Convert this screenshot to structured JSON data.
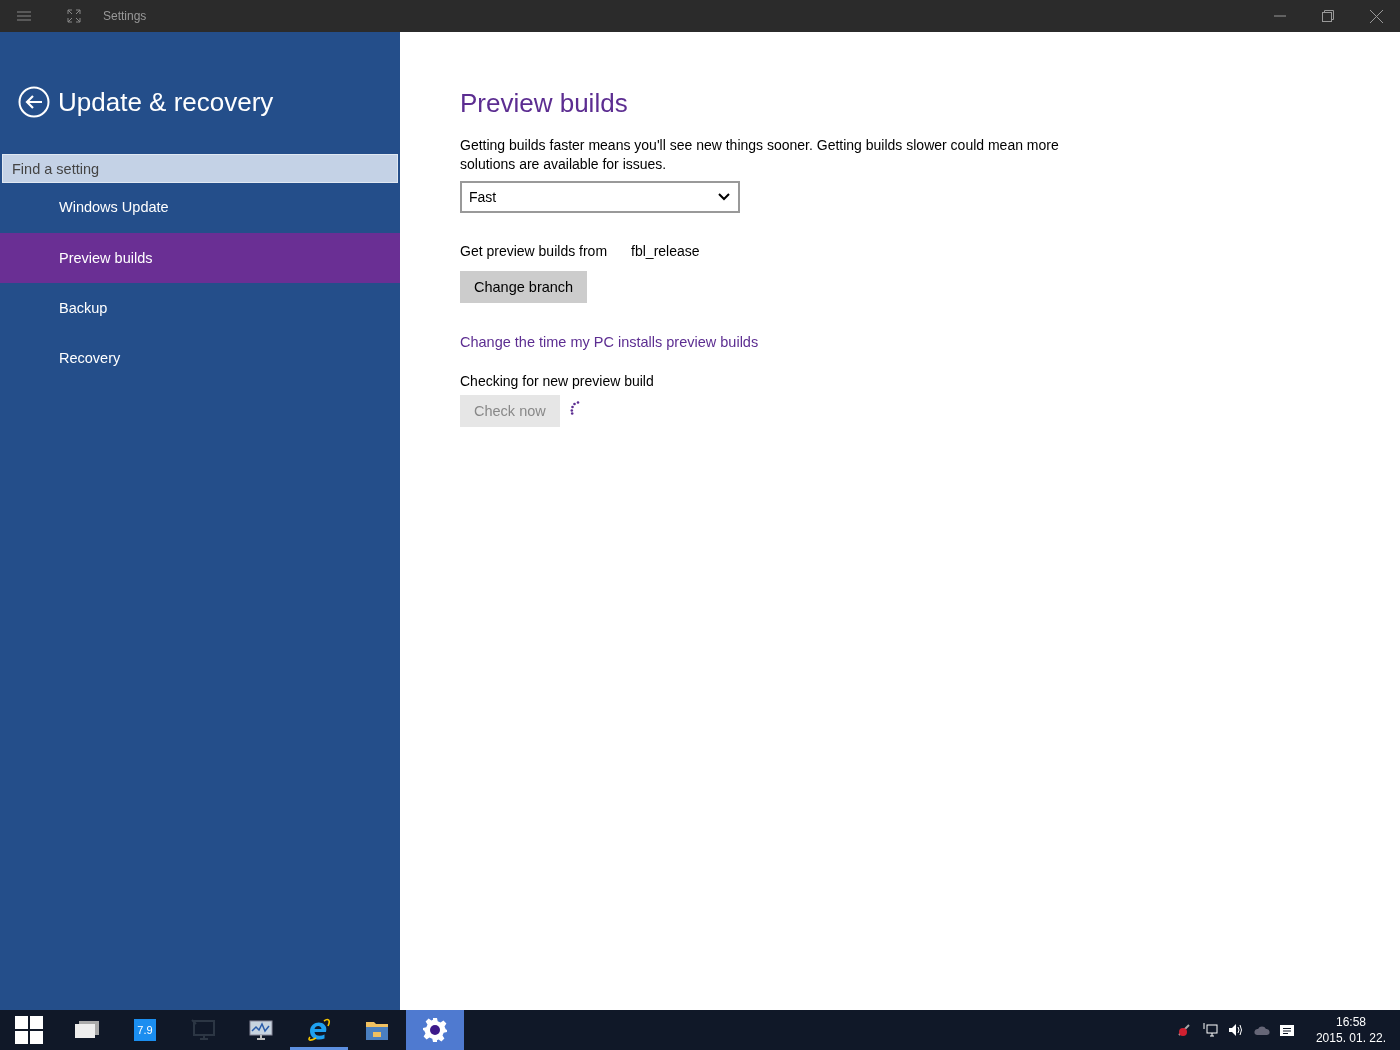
{
  "title_bar": {
    "title": "Settings"
  },
  "sidebar": {
    "heading": "Update & recovery",
    "search": {
      "placeholder": "Find a setting"
    },
    "items": [
      {
        "label": "Windows Update",
        "selected": false
      },
      {
        "label": "Preview builds",
        "selected": true
      },
      {
        "label": "Backup",
        "selected": false
      },
      {
        "label": "Recovery",
        "selected": false
      }
    ]
  },
  "content": {
    "heading": "Preview builds",
    "description": "Getting builds faster means you'll see new things sooner. Getting builds slower could mean more solutions are available for issues.",
    "ring_dropdown": {
      "value": "Fast"
    },
    "branch_label": "Get preview builds from",
    "branch_value": "fbl_release",
    "change_branch_button": "Change branch",
    "schedule_link": "Change the time my PC installs preview builds",
    "check_status": "Checking for new preview build",
    "check_button": {
      "label": "Check now",
      "disabled": true
    },
    "checking": true
  },
  "taskbar": {
    "apps": [
      {
        "kind": "task-view",
        "running": false,
        "selected": false
      },
      {
        "kind": "tile",
        "text": "7.9",
        "running": false,
        "selected": false
      },
      {
        "kind": "monitor",
        "running": false,
        "selected": false
      },
      {
        "kind": "performance",
        "running": false,
        "selected": false
      },
      {
        "kind": "browser",
        "running": true,
        "selected": false
      },
      {
        "kind": "folder",
        "running": false,
        "selected": false
      },
      {
        "kind": "settings",
        "running": true,
        "selected": true
      }
    ],
    "clock": {
      "time": "16:58",
      "date": "2015. 01. 22."
    }
  }
}
